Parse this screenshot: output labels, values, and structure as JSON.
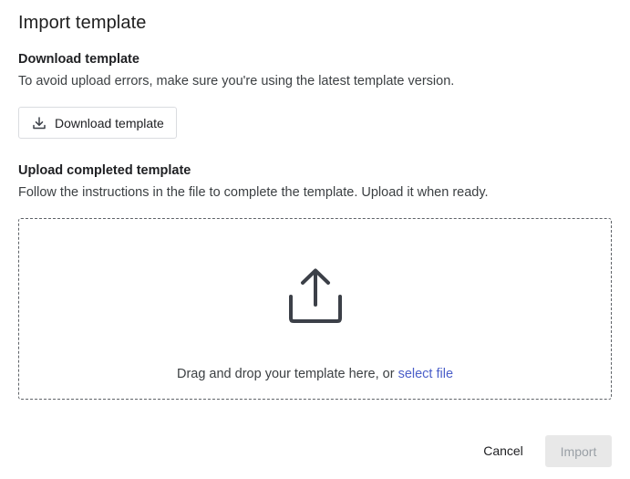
{
  "dialog": {
    "title": "Import template"
  },
  "download_section": {
    "heading": "Download template",
    "description": "To avoid upload errors, make sure you're using the latest template version.",
    "button_label": "Download template",
    "button_icon": "download-icon"
  },
  "upload_section": {
    "heading": "Upload completed template",
    "description": "Follow the instructions in the file to complete the template. Upload it when ready.",
    "dropzone": {
      "icon": "upload-icon",
      "prompt": "Drag and drop your template here, or",
      "link_label": "select file"
    }
  },
  "footer": {
    "cancel_label": "Cancel",
    "import_label": "Import",
    "import_disabled": true
  },
  "colors": {
    "link": "#4b5fc9",
    "disabled_button_bg": "#e8e8e8",
    "disabled_button_text": "#9aa0a6",
    "icon": "#3c4048"
  }
}
